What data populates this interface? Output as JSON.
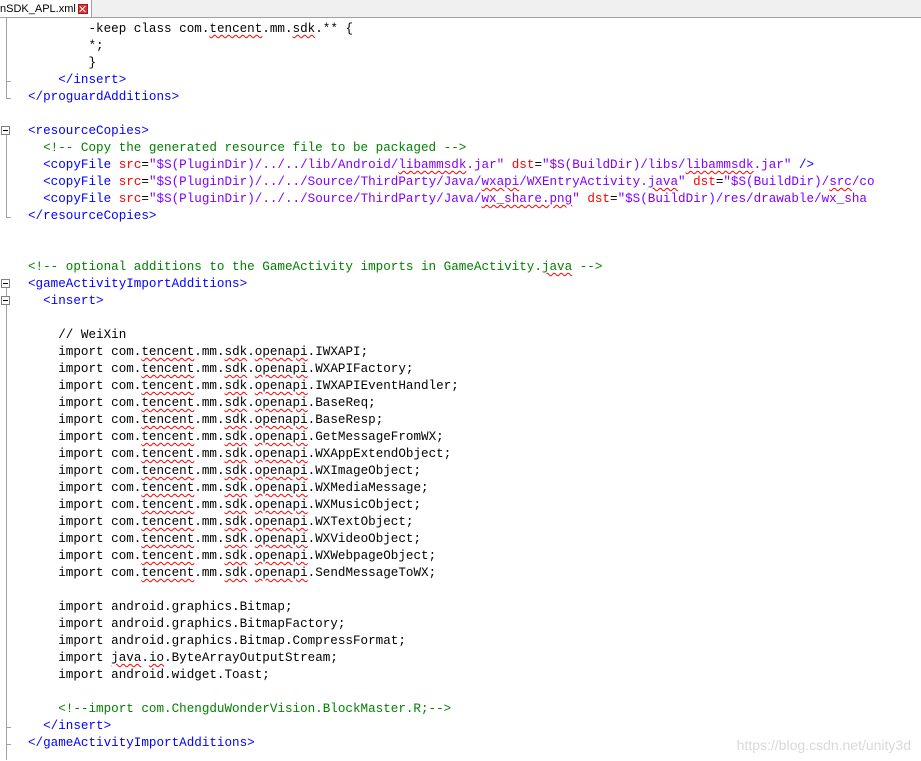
{
  "tab": {
    "label": "nSDK_APL.xml"
  },
  "watermark": "https://blog.csdn.net/unity3d",
  "colors": {
    "tag": "#0000ff",
    "attribute": "#ff0000",
    "value": "#8000ff",
    "comment": "#008000",
    "text": "#000000"
  },
  "lines": [
    [
      {
        "t": "x",
        "s": "        -keep class com."
      },
      {
        "t": "x",
        "s": "tencent",
        "sq": 1
      },
      {
        "t": "x",
        "s": ".mm."
      },
      {
        "t": "x",
        "s": "sdk",
        "sq": 1
      },
      {
        "t": "x",
        "s": ".** {"
      }
    ],
    [
      {
        "t": "x",
        "s": "        *;"
      }
    ],
    [
      {
        "t": "x",
        "s": "        }"
      }
    ],
    [
      {
        "t": "t",
        "s": "    </insert>"
      }
    ],
    [
      {
        "t": "t",
        "s": "</proguardAdditions>"
      }
    ],
    [],
    [
      {
        "t": "t",
        "s": "<resourceCopies>"
      }
    ],
    [
      {
        "t": "c",
        "s": "  <!-- Copy the generated resource file to be packaged -->"
      }
    ],
    [
      {
        "t": "t",
        "s": "  <copyFile "
      },
      {
        "t": "a",
        "s": "src"
      },
      {
        "t": "x",
        "s": "="
      },
      {
        "t": "v",
        "s": "\"$S(PluginDir)/../../lib/Android/"
      },
      {
        "t": "v",
        "s": "libammsdk",
        "sq": 1
      },
      {
        "t": "v",
        "s": ".jar\""
      },
      {
        "t": "x",
        "s": " "
      },
      {
        "t": "a",
        "s": "dst"
      },
      {
        "t": "x",
        "s": "="
      },
      {
        "t": "v",
        "s": "\"$S(BuildDir)/libs/"
      },
      {
        "t": "v",
        "s": "libammsdk",
        "sq": 1
      },
      {
        "t": "v",
        "s": ".jar\""
      },
      {
        "t": "t",
        "s": " />"
      }
    ],
    [
      {
        "t": "t",
        "s": "  <copyFile "
      },
      {
        "t": "a",
        "s": "src"
      },
      {
        "t": "x",
        "s": "="
      },
      {
        "t": "v",
        "s": "\"$S(PluginDir)/../../Source/ThirdParty/Java/"
      },
      {
        "t": "v",
        "s": "wxapi",
        "sq": 1
      },
      {
        "t": "v",
        "s": "/WXEntryActivity."
      },
      {
        "t": "v",
        "s": "java",
        "sq": 1
      },
      {
        "t": "v",
        "s": "\""
      },
      {
        "t": "x",
        "s": " "
      },
      {
        "t": "a",
        "s": "dst"
      },
      {
        "t": "x",
        "s": "="
      },
      {
        "t": "v",
        "s": "\"$S(BuildDir)/"
      },
      {
        "t": "v",
        "s": "src",
        "sq": 1
      },
      {
        "t": "v",
        "s": "/co"
      }
    ],
    [
      {
        "t": "t",
        "s": "  <copyFile "
      },
      {
        "t": "a",
        "s": "src"
      },
      {
        "t": "x",
        "s": "="
      },
      {
        "t": "v",
        "s": "\"$S(PluginDir)/../../Source/ThirdParty/Java/"
      },
      {
        "t": "v",
        "s": "wx_share.png",
        "sq": 1
      },
      {
        "t": "v",
        "s": "\""
      },
      {
        "t": "x",
        "s": " "
      },
      {
        "t": "a",
        "s": "dst"
      },
      {
        "t": "x",
        "s": "="
      },
      {
        "t": "v",
        "s": "\"$S(BuildDir)/res/drawable/wx_sha"
      }
    ],
    [
      {
        "t": "t",
        "s": "</resourceCopies>"
      }
    ],
    [],
    [],
    [
      {
        "t": "c",
        "s": "<!-- optional additions to the GameActivity imports in GameActivity."
      },
      {
        "t": "c",
        "s": "java",
        "sq": 1
      },
      {
        "t": "c",
        "s": " -->"
      }
    ],
    [
      {
        "t": "t",
        "s": "<gameActivityImportAdditions>"
      }
    ],
    [
      {
        "t": "t",
        "s": "  <insert>"
      }
    ],
    [],
    [
      {
        "t": "x",
        "s": "    // WeiXin"
      }
    ],
    [
      {
        "t": "x",
        "s": "    import com."
      },
      {
        "t": "x",
        "s": "tencent",
        "sq": 1
      },
      {
        "t": "x",
        "s": ".mm."
      },
      {
        "t": "x",
        "s": "sdk",
        "sq": 1
      },
      {
        "t": "x",
        "s": "."
      },
      {
        "t": "x",
        "s": "openapi",
        "sq": 1
      },
      {
        "t": "x",
        "s": ".IWXAPI;"
      }
    ],
    [
      {
        "t": "x",
        "s": "    import com."
      },
      {
        "t": "x",
        "s": "tencent",
        "sq": 1
      },
      {
        "t": "x",
        "s": ".mm."
      },
      {
        "t": "x",
        "s": "sdk",
        "sq": 1
      },
      {
        "t": "x",
        "s": "."
      },
      {
        "t": "x",
        "s": "openapi",
        "sq": 1
      },
      {
        "t": "x",
        "s": ".WXAPIFactory;"
      }
    ],
    [
      {
        "t": "x",
        "s": "    import com."
      },
      {
        "t": "x",
        "s": "tencent",
        "sq": 1
      },
      {
        "t": "x",
        "s": ".mm."
      },
      {
        "t": "x",
        "s": "sdk",
        "sq": 1
      },
      {
        "t": "x",
        "s": "."
      },
      {
        "t": "x",
        "s": "openapi",
        "sq": 1
      },
      {
        "t": "x",
        "s": ".IWXAPIEventHandler;"
      }
    ],
    [
      {
        "t": "x",
        "s": "    import com."
      },
      {
        "t": "x",
        "s": "tencent",
        "sq": 1
      },
      {
        "t": "x",
        "s": ".mm."
      },
      {
        "t": "x",
        "s": "sdk",
        "sq": 1
      },
      {
        "t": "x",
        "s": "."
      },
      {
        "t": "x",
        "s": "openapi",
        "sq": 1
      },
      {
        "t": "x",
        "s": ".BaseReq;"
      }
    ],
    [
      {
        "t": "x",
        "s": "    import com."
      },
      {
        "t": "x",
        "s": "tencent",
        "sq": 1
      },
      {
        "t": "x",
        "s": ".mm."
      },
      {
        "t": "x",
        "s": "sdk",
        "sq": 1
      },
      {
        "t": "x",
        "s": "."
      },
      {
        "t": "x",
        "s": "openapi",
        "sq": 1
      },
      {
        "t": "x",
        "s": ".BaseResp;"
      }
    ],
    [
      {
        "t": "x",
        "s": "    import com."
      },
      {
        "t": "x",
        "s": "tencent",
        "sq": 1
      },
      {
        "t": "x",
        "s": ".mm."
      },
      {
        "t": "x",
        "s": "sdk",
        "sq": 1
      },
      {
        "t": "x",
        "s": "."
      },
      {
        "t": "x",
        "s": "openapi",
        "sq": 1
      },
      {
        "t": "x",
        "s": ".GetMessageFromWX;"
      }
    ],
    [
      {
        "t": "x",
        "s": "    import com."
      },
      {
        "t": "x",
        "s": "tencent",
        "sq": 1
      },
      {
        "t": "x",
        "s": ".mm."
      },
      {
        "t": "x",
        "s": "sdk",
        "sq": 1
      },
      {
        "t": "x",
        "s": "."
      },
      {
        "t": "x",
        "s": "openapi",
        "sq": 1
      },
      {
        "t": "x",
        "s": ".WXAppExtendObject;"
      }
    ],
    [
      {
        "t": "x",
        "s": "    import com."
      },
      {
        "t": "x",
        "s": "tencent",
        "sq": 1
      },
      {
        "t": "x",
        "s": ".mm."
      },
      {
        "t": "x",
        "s": "sdk",
        "sq": 1
      },
      {
        "t": "x",
        "s": "."
      },
      {
        "t": "x",
        "s": "openapi",
        "sq": 1
      },
      {
        "t": "x",
        "s": ".WXImageObject;"
      }
    ],
    [
      {
        "t": "x",
        "s": "    import com."
      },
      {
        "t": "x",
        "s": "tencent",
        "sq": 1
      },
      {
        "t": "x",
        "s": ".mm."
      },
      {
        "t": "x",
        "s": "sdk",
        "sq": 1
      },
      {
        "t": "x",
        "s": "."
      },
      {
        "t": "x",
        "s": "openapi",
        "sq": 1
      },
      {
        "t": "x",
        "s": ".WXMediaMessage;"
      }
    ],
    [
      {
        "t": "x",
        "s": "    import com."
      },
      {
        "t": "x",
        "s": "tencent",
        "sq": 1
      },
      {
        "t": "x",
        "s": ".mm."
      },
      {
        "t": "x",
        "s": "sdk",
        "sq": 1
      },
      {
        "t": "x",
        "s": "."
      },
      {
        "t": "x",
        "s": "openapi",
        "sq": 1
      },
      {
        "t": "x",
        "s": ".WXMusicObject;"
      }
    ],
    [
      {
        "t": "x",
        "s": "    import com."
      },
      {
        "t": "x",
        "s": "tencent",
        "sq": 1
      },
      {
        "t": "x",
        "s": ".mm."
      },
      {
        "t": "x",
        "s": "sdk",
        "sq": 1
      },
      {
        "t": "x",
        "s": "."
      },
      {
        "t": "x",
        "s": "openapi",
        "sq": 1
      },
      {
        "t": "x",
        "s": ".WXTextObject;"
      }
    ],
    [
      {
        "t": "x",
        "s": "    import com."
      },
      {
        "t": "x",
        "s": "tencent",
        "sq": 1
      },
      {
        "t": "x",
        "s": ".mm."
      },
      {
        "t": "x",
        "s": "sdk",
        "sq": 1
      },
      {
        "t": "x",
        "s": "."
      },
      {
        "t": "x",
        "s": "openapi",
        "sq": 1
      },
      {
        "t": "x",
        "s": ".WXVideoObject;"
      }
    ],
    [
      {
        "t": "x",
        "s": "    import com."
      },
      {
        "t": "x",
        "s": "tencent",
        "sq": 1
      },
      {
        "t": "x",
        "s": ".mm."
      },
      {
        "t": "x",
        "s": "sdk",
        "sq": 1
      },
      {
        "t": "x",
        "s": "."
      },
      {
        "t": "x",
        "s": "openapi",
        "sq": 1
      },
      {
        "t": "x",
        "s": ".WXWebpageObject;"
      }
    ],
    [
      {
        "t": "x",
        "s": "    import com."
      },
      {
        "t": "x",
        "s": "tencent",
        "sq": 1
      },
      {
        "t": "x",
        "s": ".mm."
      },
      {
        "t": "x",
        "s": "sdk",
        "sq": 1
      },
      {
        "t": "x",
        "s": "."
      },
      {
        "t": "x",
        "s": "openapi",
        "sq": 1
      },
      {
        "t": "x",
        "s": ".SendMessageToWX;"
      }
    ],
    [],
    [
      {
        "t": "x",
        "s": "    import android.graphics.Bitmap;"
      }
    ],
    [
      {
        "t": "x",
        "s": "    import android.graphics.BitmapFactory;"
      }
    ],
    [
      {
        "t": "x",
        "s": "    import android.graphics.Bitmap.CompressFormat;"
      }
    ],
    [
      {
        "t": "x",
        "s": "    import "
      },
      {
        "t": "x",
        "s": "java",
        "sq": 1
      },
      {
        "t": "x",
        "s": "."
      },
      {
        "t": "x",
        "s": "io",
        "sq": 1
      },
      {
        "t": "x",
        "s": ".ByteArrayOutputStream;"
      }
    ],
    [
      {
        "t": "x",
        "s": "    import android.widget.Toast;"
      }
    ],
    [],
    [
      {
        "t": "c",
        "s": "    <!--import com.ChengduWonderVision.BlockMaster.R;-->"
      }
    ],
    [
      {
        "t": "t",
        "s": "  </insert>"
      }
    ],
    [
      {
        "t": "t",
        "s": "</gameActivityImportAdditions>"
      }
    ]
  ]
}
